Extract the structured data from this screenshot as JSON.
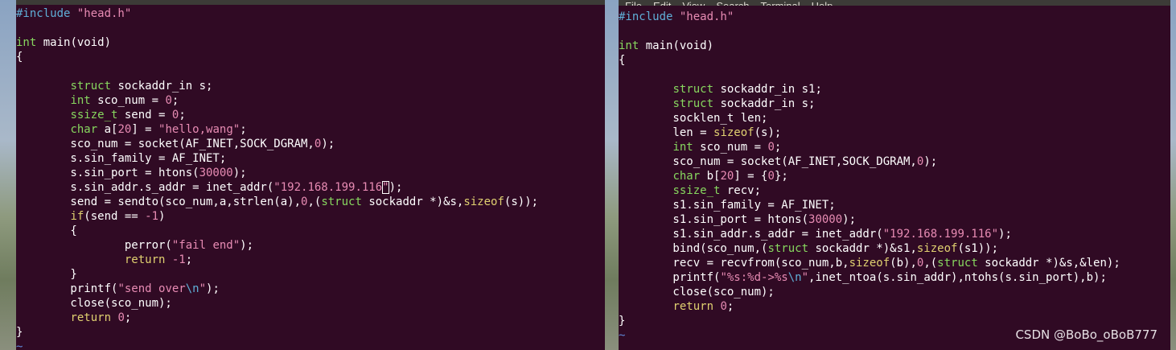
{
  "left_terminal": {
    "lines": [
      [
        {
          "t": "#include ",
          "c": "pp"
        },
        {
          "t": "\"head.h\"",
          "c": "str"
        }
      ],
      [],
      [
        {
          "t": "int",
          "c": "kw"
        },
        {
          "t": " main(void)"
        }
      ],
      [
        {
          "t": "{"
        }
      ],
      [],
      [
        {
          "t": "        "
        },
        {
          "t": "struct",
          "c": "kw"
        },
        {
          "t": " sockaddr_in s;"
        }
      ],
      [
        {
          "t": "        "
        },
        {
          "t": "int",
          "c": "kw"
        },
        {
          "t": " sco_num = "
        },
        {
          "t": "0",
          "c": "num"
        },
        {
          "t": ";"
        }
      ],
      [
        {
          "t": "        "
        },
        {
          "t": "ssize_t",
          "c": "kw"
        },
        {
          "t": " send = "
        },
        {
          "t": "0",
          "c": "num"
        },
        {
          "t": ";"
        }
      ],
      [
        {
          "t": "        "
        },
        {
          "t": "char",
          "c": "kw"
        },
        {
          "t": " a["
        },
        {
          "t": "20",
          "c": "num"
        },
        {
          "t": "] = "
        },
        {
          "t": "\"hello,wang\"",
          "c": "str"
        },
        {
          "t": ";"
        }
      ],
      [
        {
          "t": "        sco_num = socket(AF_INET,SOCK_DGRAM,"
        },
        {
          "t": "0",
          "c": "num"
        },
        {
          "t": ");"
        }
      ],
      [
        {
          "t": "        s.sin_family = AF_INET;"
        }
      ],
      [
        {
          "t": "        s.sin_port = htons("
        },
        {
          "t": "30000",
          "c": "num"
        },
        {
          "t": ");"
        }
      ],
      [
        {
          "t": "        s.sin_addr.s_addr = inet_addr("
        },
        {
          "t": "\"192.168.199.116",
          "c": "str"
        },
        {
          "t": "\"",
          "c": "str cursor"
        },
        {
          "t": ");"
        }
      ],
      [
        {
          "t": "        send = sendto(sco_num,a,strlen(a),"
        },
        {
          "t": "0",
          "c": "num"
        },
        {
          "t": ",("
        },
        {
          "t": "struct",
          "c": "kw"
        },
        {
          "t": " sockaddr *)&s,"
        },
        {
          "t": "sizeof",
          "c": "func"
        },
        {
          "t": "(s));"
        }
      ],
      [
        {
          "t": "        "
        },
        {
          "t": "if",
          "c": "ctl"
        },
        {
          "t": "(send == "
        },
        {
          "t": "-1",
          "c": "num"
        },
        {
          "t": ")"
        }
      ],
      [
        {
          "t": "        {"
        }
      ],
      [
        {
          "t": "                perror("
        },
        {
          "t": "\"fail end\"",
          "c": "str"
        },
        {
          "t": ");"
        }
      ],
      [
        {
          "t": "                "
        },
        {
          "t": "return",
          "c": "ctl"
        },
        {
          "t": " "
        },
        {
          "t": "-1",
          "c": "num"
        },
        {
          "t": ";"
        }
      ],
      [
        {
          "t": "        }"
        }
      ],
      [
        {
          "t": "        printf("
        },
        {
          "t": "\"send over",
          "c": "str"
        },
        {
          "t": "\\n",
          "c": "pp"
        },
        {
          "t": "\"",
          "c": "str"
        },
        {
          "t": ");"
        }
      ],
      [
        {
          "t": "        close(sco_num);"
        }
      ],
      [
        {
          "t": "        "
        },
        {
          "t": "return",
          "c": "ctl"
        },
        {
          "t": " "
        },
        {
          "t": "0",
          "c": "num"
        },
        {
          "t": ";"
        }
      ],
      [
        {
          "t": "}"
        }
      ],
      [
        {
          "t": "~",
          "c": "tilde"
        }
      ]
    ]
  },
  "right_terminal": {
    "menu": [
      "File",
      "Edit",
      "View",
      "Search",
      "Terminal",
      "Help"
    ],
    "lines": [
      [
        {
          "t": "#include ",
          "c": "pp"
        },
        {
          "t": "\"head.h\"",
          "c": "str"
        }
      ],
      [],
      [
        {
          "t": "int",
          "c": "kw"
        },
        {
          "t": " main(void)"
        }
      ],
      [
        {
          "t": "{"
        }
      ],
      [],
      [
        {
          "t": "        "
        },
        {
          "t": "struct",
          "c": "kw"
        },
        {
          "t": " sockaddr_in s1;"
        }
      ],
      [
        {
          "t": "        "
        },
        {
          "t": "struct",
          "c": "kw"
        },
        {
          "t": " sockaddr_in s;"
        }
      ],
      [
        {
          "t": "        socklen_t len;"
        }
      ],
      [
        {
          "t": "        len = "
        },
        {
          "t": "sizeof",
          "c": "func"
        },
        {
          "t": "(s);"
        }
      ],
      [
        {
          "t": "        "
        },
        {
          "t": "int",
          "c": "kw"
        },
        {
          "t": " sco_num = "
        },
        {
          "t": "0",
          "c": "num"
        },
        {
          "t": ";"
        }
      ],
      [
        {
          "t": "        sco_num = socket(AF_INET,SOCK_DGRAM,"
        },
        {
          "t": "0",
          "c": "num"
        },
        {
          "t": ");"
        }
      ],
      [
        {
          "t": "        "
        },
        {
          "t": "char",
          "c": "kw"
        },
        {
          "t": " b["
        },
        {
          "t": "20",
          "c": "num"
        },
        {
          "t": "] = {"
        },
        {
          "t": "0",
          "c": "num"
        },
        {
          "t": "};"
        }
      ],
      [
        {
          "t": "        "
        },
        {
          "t": "ssize_t",
          "c": "kw"
        },
        {
          "t": " recv;"
        }
      ],
      [
        {
          "t": "        s1.sin_family = AF_INET;"
        }
      ],
      [
        {
          "t": "        s1.sin_port = htons("
        },
        {
          "t": "30000",
          "c": "num"
        },
        {
          "t": ");"
        }
      ],
      [
        {
          "t": "        s1.sin_addr.s_addr = inet_addr("
        },
        {
          "t": "\"192.168.199.116\"",
          "c": "str"
        },
        {
          "t": ");"
        }
      ],
      [
        {
          "t": "        bind(sco_num,("
        },
        {
          "t": "struct",
          "c": "kw"
        },
        {
          "t": " sockaddr *)&s1,"
        },
        {
          "t": "sizeof",
          "c": "func"
        },
        {
          "t": "(s1));"
        }
      ],
      [
        {
          "t": "        recv = recvfrom(sco_num,b,"
        },
        {
          "t": "sizeof",
          "c": "func"
        },
        {
          "t": "(b),"
        },
        {
          "t": "0",
          "c": "num"
        },
        {
          "t": ",("
        },
        {
          "t": "struct",
          "c": "kw"
        },
        {
          "t": " sockaddr *)&s,&len);"
        }
      ],
      [
        {
          "t": "        printf("
        },
        {
          "t": "\"%s:%d->%s",
          "c": "str"
        },
        {
          "t": "\\n",
          "c": "pp"
        },
        {
          "t": "\"",
          "c": "str"
        },
        {
          "t": ",inet_ntoa(s.sin_addr),ntohs(s.sin_port),b);"
        }
      ],
      [
        {
          "t": "        close(sco_num);"
        }
      ],
      [
        {
          "t": "        "
        },
        {
          "t": "return",
          "c": "ctl"
        },
        {
          "t": " "
        },
        {
          "t": "0",
          "c": "num"
        },
        {
          "t": ";"
        }
      ],
      [
        {
          "t": "}"
        }
      ],
      [
        {
          "t": "~",
          "c": "tilde"
        }
      ]
    ]
  },
  "watermark": "CSDN @BoBo_oBoB777",
  "colors": {
    "terminal_bg": "#300a24",
    "text": "#ffffff",
    "type_keyword": "#87d75f",
    "string_literal": "#e78bb3",
    "preprocessor": "#5fafd7",
    "control_keyword": "#e0d070",
    "empty_line_marker": "#5f87d7"
  }
}
